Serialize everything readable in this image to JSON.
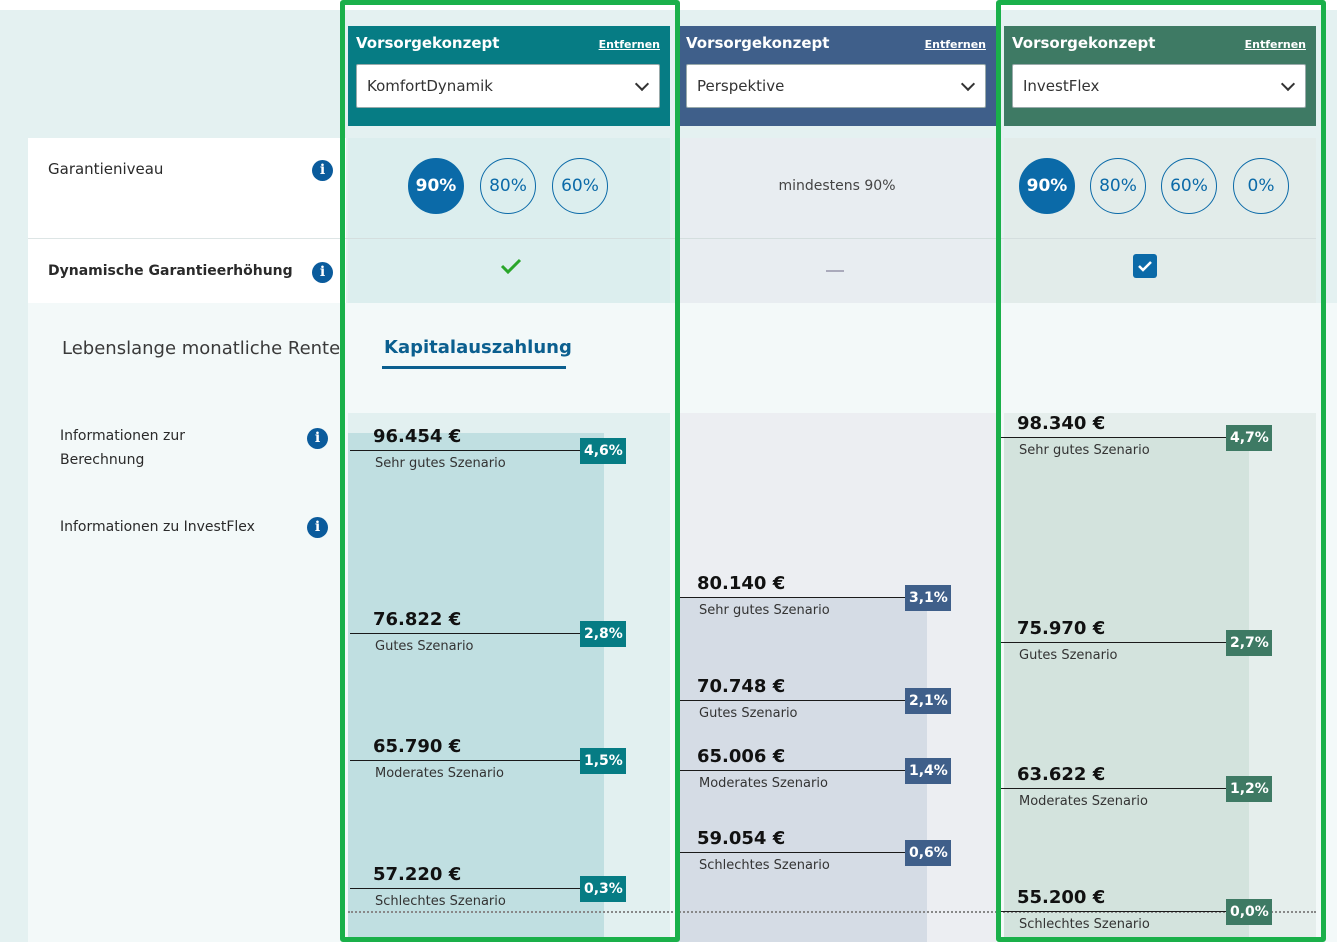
{
  "colors": {
    "col1_header": "#067c84",
    "col2_header": "#3f5f8a",
    "col3_header": "#3e7a64",
    "badge1": "#067c84",
    "badge2": "#3f5f8a",
    "badge3": "#3e7a64",
    "pill_blue": "#0b6aa8",
    "check_green": "#2aa62a",
    "highlight_green": "#1ab04a"
  },
  "rows": {
    "garantieniveau": "Garantieniveau",
    "dynamische": "Dynamische Garantieerhöhung",
    "tab_rente": "Lebenslange monatliche Rente",
    "tab_kapital": "Kapitalauszahlung",
    "info_berechnung": "Informationen zur\nBerechnung",
    "info_berechnung_1": "Informationen zur",
    "info_berechnung_2": "Berechnung",
    "info_investflex": "Informationen zu InvestFlex"
  },
  "columns": [
    {
      "title": "Vorsorgekonzept",
      "remove": "Entfernen",
      "selected": "KomfortDynamik",
      "guarantee_options": [
        "90%",
        "80%",
        "60%"
      ],
      "guarantee_selected": "90%",
      "dynamic_icon": "check-icon",
      "scenarios": [
        {
          "amount": "96.454 €",
          "label": "Sehr gutes Szenario",
          "rate": "4,6%"
        },
        {
          "amount": "76.822 €",
          "label": "Gutes Szenario",
          "rate": "2,8%"
        },
        {
          "amount": "65.790 €",
          "label": "Moderates Szenario",
          "rate": "1,5%"
        },
        {
          "amount": "57.220 €",
          "label": "Schlechtes Szenario",
          "rate": "0,3%"
        }
      ]
    },
    {
      "title": "Vorsorgekonzept",
      "remove": "Entfernen",
      "selected": "Perspektive",
      "guarantee_text": "mindestens 90%",
      "dynamic_icon": "dash-icon",
      "scenarios": [
        {
          "amount": "80.140 €",
          "label": "Sehr gutes Szenario",
          "rate": "3,1%"
        },
        {
          "amount": "70.748 €",
          "label": "Gutes Szenario",
          "rate": "2,1%"
        },
        {
          "amount": "65.006 €",
          "label": "Moderates Szenario",
          "rate": "1,4%"
        },
        {
          "amount": "59.054 €",
          "label": "Schlechtes Szenario",
          "rate": "0,6%"
        }
      ]
    },
    {
      "title": "Vorsorgekonzept",
      "remove": "Entfernen",
      "selected": "InvestFlex",
      "guarantee_options": [
        "90%",
        "80%",
        "60%",
        "0%"
      ],
      "guarantee_selected": "90%",
      "dynamic_icon": "checkbox-checked-icon",
      "scenarios": [
        {
          "amount": "98.340 €",
          "label": "Sehr gutes Szenario",
          "rate": "4,7%"
        },
        {
          "amount": "75.970 €",
          "label": "Gutes Szenario",
          "rate": "2,7%"
        },
        {
          "amount": "63.622 €",
          "label": "Moderates Szenario",
          "rate": "1,2%"
        },
        {
          "amount": "55.200 €",
          "label": "Schlechtes Szenario",
          "rate": "0,0%"
        }
      ]
    }
  ]
}
